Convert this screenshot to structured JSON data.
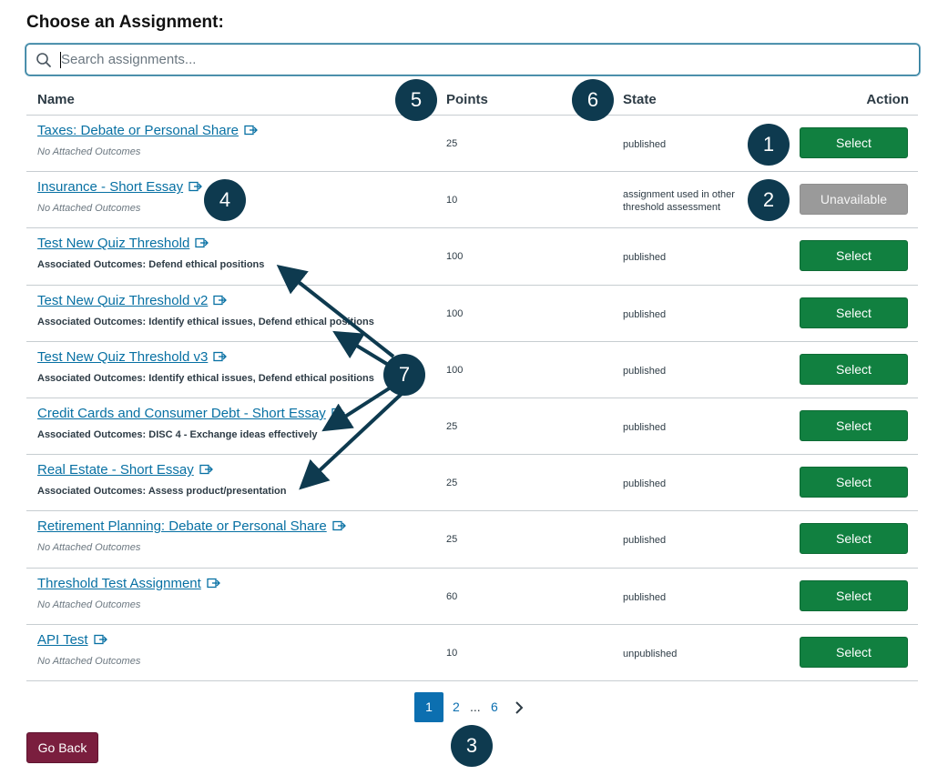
{
  "page_title": "Choose an Assignment:",
  "search": {
    "placeholder": "Search assignments..."
  },
  "columns": {
    "name": "Name",
    "points": "Points",
    "state": "State",
    "action": "Action"
  },
  "assignments": [
    {
      "name": "Taxes: Debate or Personal Share",
      "outcomes": "No Attached Outcomes",
      "has_outcomes": false,
      "points": "25",
      "state": "published",
      "action": "Select",
      "available": true
    },
    {
      "name": "Insurance - Short Essay",
      "outcomes": "No Attached Outcomes",
      "has_outcomes": false,
      "points": "10",
      "state": "assignment used in other threshold assessment",
      "action": "Unavailable",
      "available": false
    },
    {
      "name": "Test New Quiz Threshold",
      "outcomes": "Associated Outcomes: Defend ethical positions",
      "has_outcomes": true,
      "points": "100",
      "state": "published",
      "action": "Select",
      "available": true
    },
    {
      "name": "Test New Quiz Threshold v2",
      "outcomes": "Associated Outcomes: Identify ethical issues, Defend ethical positions",
      "has_outcomes": true,
      "points": "100",
      "state": "published",
      "action": "Select",
      "available": true
    },
    {
      "name": "Test New Quiz Threshold v3",
      "outcomes": "Associated Outcomes: Identify ethical issues, Defend ethical positions",
      "has_outcomes": true,
      "points": "100",
      "state": "published",
      "action": "Select",
      "available": true
    },
    {
      "name": "Credit Cards and Consumer Debt - Short Essay",
      "outcomes": "Associated Outcomes: DISC 4 - Exchange ideas effectively",
      "has_outcomes": true,
      "points": "25",
      "state": "published",
      "action": "Select",
      "available": true
    },
    {
      "name": "Real Estate - Short Essay",
      "outcomes": "Associated Outcomes: Assess product/presentation",
      "has_outcomes": true,
      "points": "25",
      "state": "published",
      "action": "Select",
      "available": true
    },
    {
      "name": "Retirement Planning: Debate or Personal Share",
      "outcomes": "No Attached Outcomes",
      "has_outcomes": false,
      "points": "25",
      "state": "published",
      "action": "Select",
      "available": true
    },
    {
      "name": "Threshold Test Assignment",
      "outcomes": "No Attached Outcomes",
      "has_outcomes": false,
      "points": "60",
      "state": "published",
      "action": "Select",
      "available": true
    },
    {
      "name": "API Test",
      "outcomes": "No Attached Outcomes",
      "has_outcomes": false,
      "points": "10",
      "state": "unpublished",
      "action": "Select",
      "available": true
    }
  ],
  "pagination": {
    "current": "1",
    "page_2": "2",
    "ellipsis": "...",
    "last": "6"
  },
  "go_back_label": "Go Back",
  "callouts": {
    "c1": "1",
    "c2": "2",
    "c3": "3",
    "c4": "4",
    "c5": "5",
    "c6": "6",
    "c7": "7"
  },
  "colors": {
    "primary_button": "#118040",
    "disabled_button": "#9a9a9a",
    "link": "#0770a3",
    "go_back": "#7a1e3e",
    "callout": "#0e3a4f",
    "page_active": "#0c6fb0"
  },
  "icons": {
    "search": "search-icon",
    "external_link": "external-link-icon",
    "next": "chevron-right-icon"
  }
}
